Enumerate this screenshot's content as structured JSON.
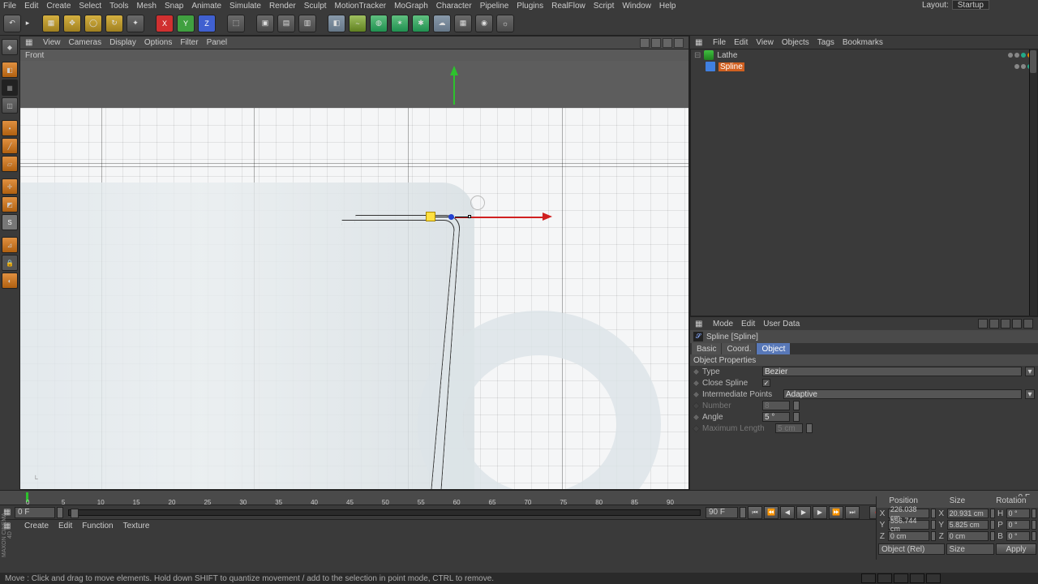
{
  "menubar": [
    "File",
    "Edit",
    "Create",
    "Select",
    "Tools",
    "Mesh",
    "Snap",
    "Animate",
    "Simulate",
    "Render",
    "Sculpt",
    "MotionTracker",
    "MoGraph",
    "Character",
    "Pipeline",
    "Plugins",
    "RealFlow",
    "Script",
    "Window",
    "Help"
  ],
  "layout": {
    "label": "Layout:",
    "value": "Startup"
  },
  "viewport": {
    "menus": [
      "View",
      "Cameras",
      "Display",
      "Options",
      "Filter",
      "Panel"
    ],
    "label": "Front"
  },
  "axes": {
    "x": "X",
    "y": "Y",
    "z": "Z"
  },
  "object_panel": {
    "menus": [
      "File",
      "Edit",
      "View",
      "Objects",
      "Tags",
      "Bookmarks"
    ],
    "items": [
      {
        "name": "Lathe",
        "selected": false
      },
      {
        "name": "Spline",
        "selected": true
      }
    ]
  },
  "attrib": {
    "menus": [
      "Mode",
      "Edit",
      "User Data"
    ],
    "object_name": "Spline [Spline]",
    "tabs": [
      "Basic",
      "Coord.",
      "Object"
    ],
    "active_tab": 2,
    "header": "Object Properties",
    "props": {
      "type_label": "Type",
      "type_value": "Bezier",
      "close_label": "Close Spline",
      "close_checked": true,
      "interp_label": "Intermediate Points",
      "interp_value": "Adaptive",
      "number_label": "Number",
      "number_value": "8",
      "angle_label": "Angle",
      "angle_value": "5 °",
      "maxlen_label": "Maximum Length",
      "maxlen_value": "5 cm"
    }
  },
  "timeline": {
    "ticks": [
      "0",
      "5",
      "10",
      "15",
      "20",
      "25",
      "30",
      "35",
      "40",
      "45",
      "50",
      "55",
      "60",
      "65",
      "70",
      "75",
      "80",
      "85",
      "90"
    ],
    "start": "0 F",
    "end": "90 F",
    "end_label": "0 F"
  },
  "playback": {
    "start_frame": "0 F",
    "end_frame": "90 F"
  },
  "bottom_bar": [
    "Create",
    "Edit",
    "Function",
    "Texture"
  ],
  "coord": {
    "headers": [
      "Position",
      "Size",
      "Rotation"
    ],
    "rows": [
      {
        "axis": "X",
        "pos": "226.038 cm",
        "saxis": "X",
        "size": "20.931 cm",
        "raxis": "H",
        "rot": "0 °"
      },
      {
        "axis": "Y",
        "pos": "556.744 cm",
        "saxis": "Y",
        "size": "5.825 cm",
        "raxis": "P",
        "rot": "0 °"
      },
      {
        "axis": "Z",
        "pos": "0 cm",
        "saxis": "Z",
        "size": "0 cm",
        "raxis": "B",
        "rot": "0 °"
      }
    ],
    "mode": "Object (Rel)",
    "size_mode": "Size",
    "apply": "Apply"
  },
  "brand": "MAXON CINEMA 4D",
  "status": "Move : Click and drag to move elements. Hold down SHIFT to quantize movement / add to the selection in point mode, CTRL to remove."
}
